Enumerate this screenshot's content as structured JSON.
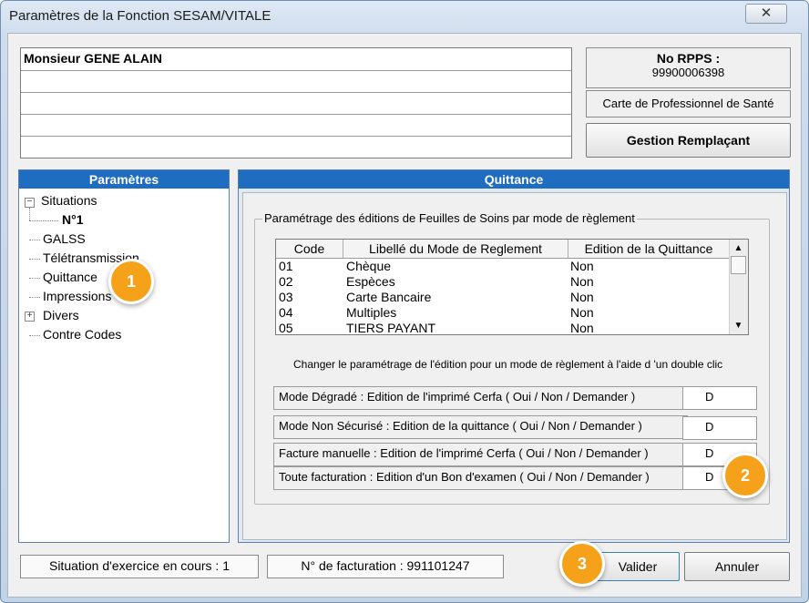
{
  "window": {
    "title": "Paramètres de la Fonction SESAM/VITALE",
    "close_glyph": "✕"
  },
  "patient": {
    "name": "Monsieur GENE ALAIN"
  },
  "rpps": {
    "label": "No RPPS :",
    "value": "99900006398"
  },
  "cps_label": "Carte de Professionnel de Santé",
  "gestion_button": "Gestion Remplaçant",
  "params_panel": {
    "title": "Paramètres",
    "tree": {
      "situations": "Situations",
      "n1": "N°1",
      "galss": "GALSS",
      "teletransmission": "Télétransmission",
      "quittance": "Quittance",
      "impressions": "Impressions",
      "divers": "Divers",
      "contre_codes": "Contre Codes",
      "minus": "−",
      "plus": "+"
    }
  },
  "quittance_panel": {
    "title": "Quittance",
    "group_label": "Paramétrage des éditions de Feuilles de Soins par mode de règlement",
    "columns": {
      "code": "Code",
      "libelle": "Libellé du Mode de Reglement",
      "edition": "Edition de la Quittance"
    },
    "rows": [
      {
        "code": "01",
        "libelle": "Chèque",
        "edition": "Non"
      },
      {
        "code": "02",
        "libelle": "Espèces",
        "edition": "Non"
      },
      {
        "code": "03",
        "libelle": "Carte Bancaire",
        "edition": "Non"
      },
      {
        "code": "04",
        "libelle": "Multiples",
        "edition": "Non"
      },
      {
        "code": "05",
        "libelle": "TIERS PAYANT",
        "edition": "Non"
      }
    ],
    "hint": "Changer le paramétrage de l'édition pour un mode de règlement à l'aide d 'un double clic",
    "options": [
      {
        "label": "Mode Dégradé : Edition de l'imprimé Cerfa  ( Oui / Non / Demander )",
        "value": "D"
      },
      {
        "label": "Mode Non Sécurisé : Edition de la quittance  ( Oui / Non / Demander )",
        "value": "D"
      },
      {
        "label": "Facture manuelle : Edition de l'imprimé Cerfa  ( Oui / Non / Demander )",
        "value": "D"
      },
      {
        "label": "Toute facturation : Edition d'un Bon d'examen ( Oui / Non / Demander )",
        "value": "D"
      }
    ]
  },
  "status": {
    "situation": "Situation d'exercice en cours : 1",
    "facturation": "N° de facturation : 991101247"
  },
  "buttons": {
    "valider": "Valider",
    "annuler": "Annuler"
  },
  "badges": {
    "b1": "1",
    "b2": "2",
    "b3": "3"
  },
  "colors": {
    "panel_header": "#1e6dc0",
    "badge": "#f5a21a"
  }
}
